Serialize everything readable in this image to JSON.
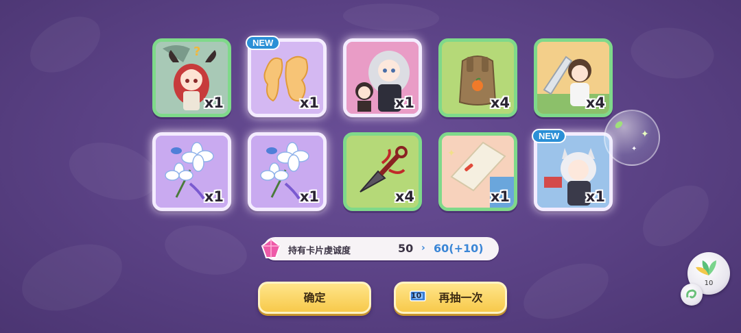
{
  "cards": [
    {
      "name": "card-demon-girl",
      "qty": "x1",
      "new": false
    },
    {
      "name": "card-bread-piece",
      "qty": "x1",
      "new": true,
      "badge": "NEW"
    },
    {
      "name": "card-silver-hair-girl",
      "qty": "x1",
      "new": false
    },
    {
      "name": "card-backpack",
      "qty": "x4",
      "new": false
    },
    {
      "name": "card-sword-girl",
      "qty": "x4",
      "new": false
    },
    {
      "name": "card-white-flower-1",
      "qty": "x1",
      "new": false
    },
    {
      "name": "card-white-flower-2",
      "qty": "x1",
      "new": false
    },
    {
      "name": "card-kunai",
      "qty": "x4",
      "new": false
    },
    {
      "name": "card-paper-scroll",
      "qty": "x1",
      "new": false
    },
    {
      "name": "card-wolf-girl",
      "qty": "x1",
      "new": true,
      "badge": "NEW"
    }
  ],
  "stats": {
    "label": "持有卡片虔诚度",
    "old_value": "50",
    "arrow": "›",
    "new_value": "60(+10)"
  },
  "buttons": {
    "confirm": "确定",
    "draw_again": "再抽一次",
    "ticket_count": "10"
  },
  "side": {
    "top_count": "10"
  },
  "colors": {
    "card_border_green": "#7fd98a",
    "button_yellow": "#f7c94b",
    "accent_blue": "#3b86d6",
    "new_badge": "#2b8fd6"
  }
}
